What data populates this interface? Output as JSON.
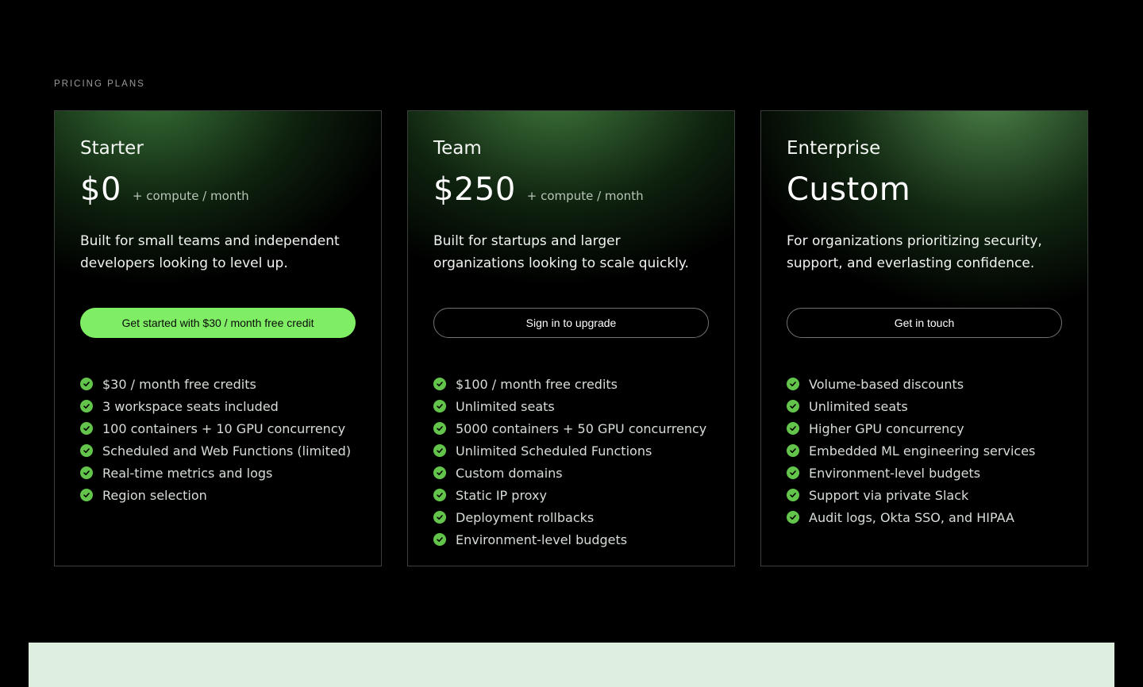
{
  "section": {
    "label": "PRICING PLANS"
  },
  "colors": {
    "accent": "#7fee64",
    "check": "#62c44a",
    "band": "#dfefdf"
  },
  "plans": [
    {
      "name": "Starter",
      "price": "$0",
      "price_suffix": "+ compute / month",
      "description": "Built for small teams and independent developers looking to level up.",
      "cta": "Get started with $30 / month free credit",
      "features": [
        "$30 / month free credits",
        "3 workspace seats included",
        "100 containers + 10 GPU concurrency",
        "Scheduled and Web Functions (limited)",
        "Real-time metrics and logs",
        "Region selection"
      ]
    },
    {
      "name": "Team",
      "price": "$250",
      "price_suffix": "+ compute / month",
      "description": "Built for startups and larger organizations looking to scale quickly.",
      "cta": "Sign in to upgrade",
      "features": [
        "$100 / month free credits",
        "Unlimited seats",
        "5000 containers + 50 GPU concurrency",
        "Unlimited Scheduled Functions",
        "Custom domains",
        "Static IP proxy",
        "Deployment rollbacks",
        "Environment-level budgets"
      ]
    },
    {
      "name": "Enterprise",
      "price": "Custom",
      "price_suffix": "",
      "description": "For organizations prioritizing security, support, and everlasting confidence.",
      "cta": "Get in touch",
      "features": [
        "Volume-based discounts",
        "Unlimited seats",
        "Higher GPU concurrency",
        "Embedded ML engineering services",
        "Environment-level budgets",
        "Support via private Slack",
        "Audit logs, Okta SSO, and HIPAA"
      ]
    }
  ]
}
